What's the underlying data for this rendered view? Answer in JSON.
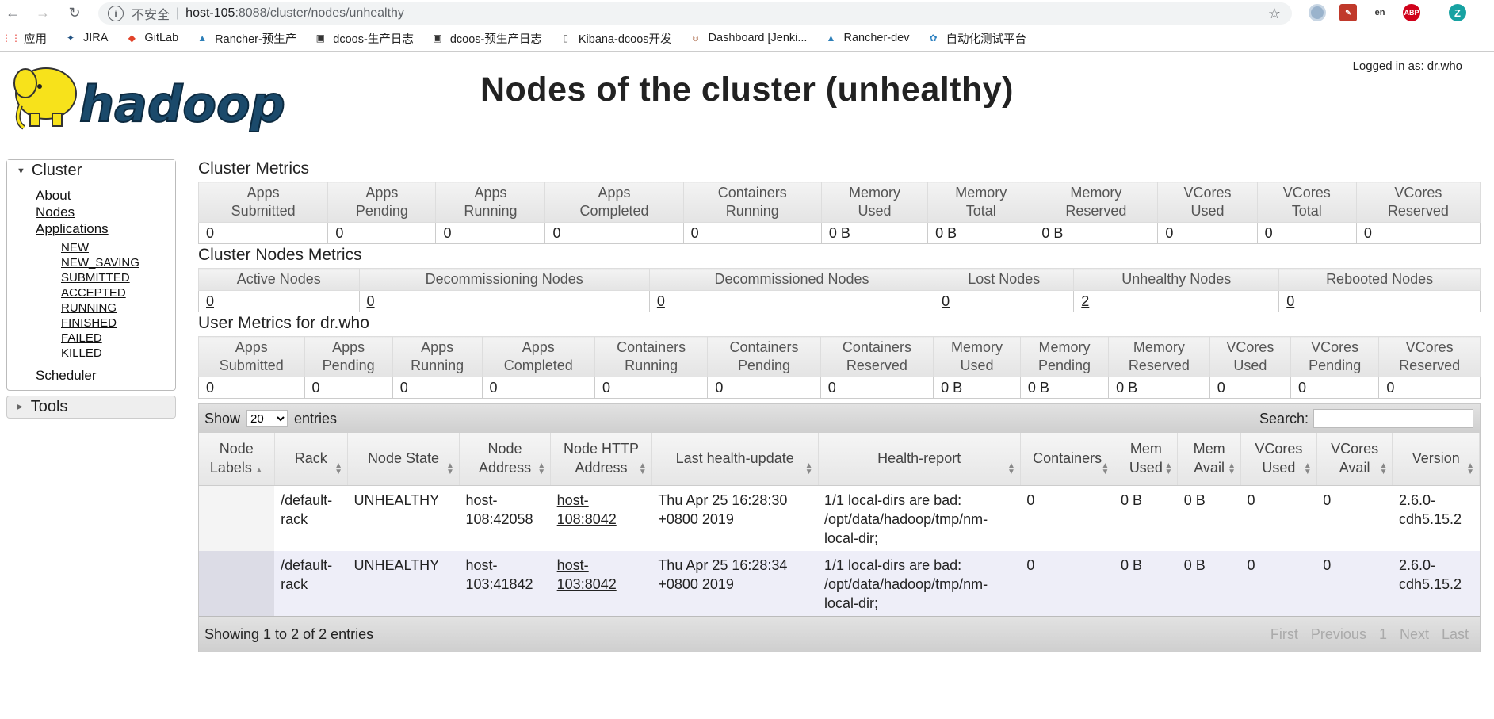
{
  "browser": {
    "security_label": "不安全",
    "url_host": "host-105",
    "url_rest": ":8088/cluster/nodes/unhealthy",
    "bookmarks": [
      {
        "label": "应用",
        "icon": "apps-grid-icon"
      },
      {
        "label": "JIRA",
        "icon": "jira-icon"
      },
      {
        "label": "GitLab",
        "icon": "gitlab-icon"
      },
      {
        "label": "Rancher-预生产",
        "icon": "rancher-icon"
      },
      {
        "label": "dcoos-生产日志",
        "icon": "terminal-icon"
      },
      {
        "label": "dcoos-预生产日志",
        "icon": "terminal-icon"
      },
      {
        "label": "Kibana-dcoos开发",
        "icon": "page-icon"
      },
      {
        "label": "Dashboard [Jenki...",
        "icon": "jenkins-icon"
      },
      {
        "label": "Rancher-dev",
        "icon": "rancher-icon"
      },
      {
        "label": "自动化测试平台",
        "icon": "test-platform-icon"
      }
    ],
    "ext_abp": "ABP",
    "profile_initial": "Z"
  },
  "header": {
    "title": "Nodes of the cluster (unhealthy)",
    "logged_in": "Logged in as: dr.who",
    "logo_text": "hadoop"
  },
  "sidebar": {
    "cluster_label": "Cluster",
    "links": [
      "About",
      "Nodes",
      "Applications"
    ],
    "app_states": [
      "NEW",
      "NEW_SAVING",
      "SUBMITTED",
      "ACCEPTED",
      "RUNNING",
      "FINISHED",
      "FAILED",
      "KILLED"
    ],
    "scheduler": "Scheduler",
    "tools_label": "Tools"
  },
  "cluster_metrics": {
    "title": "Cluster Metrics",
    "headers": [
      [
        "Apps",
        "Submitted"
      ],
      [
        "Apps",
        "Pending"
      ],
      [
        "Apps",
        "Running"
      ],
      [
        "Apps",
        "Completed"
      ],
      [
        "Containers",
        "Running"
      ],
      [
        "Memory",
        "Used"
      ],
      [
        "Memory",
        "Total"
      ],
      [
        "Memory",
        "Reserved"
      ],
      [
        "VCores",
        "Used"
      ],
      [
        "VCores",
        "Total"
      ],
      [
        "VCores",
        "Reserved"
      ]
    ],
    "values": [
      "0",
      "0",
      "0",
      "0",
      "0",
      "0 B",
      "0 B",
      "0 B",
      "0",
      "0",
      "0"
    ]
  },
  "node_metrics": {
    "title": "Cluster Nodes Metrics",
    "headers": [
      "Active Nodes",
      "Decommissioning Nodes",
      "Decommissioned Nodes",
      "Lost Nodes",
      "Unhealthy Nodes",
      "Rebooted Nodes"
    ],
    "values": [
      "0",
      "0",
      "0",
      "0",
      "2",
      "0"
    ]
  },
  "user_metrics": {
    "title": "User Metrics for dr.who",
    "headers": [
      [
        "Apps",
        "Submitted"
      ],
      [
        "Apps",
        "Pending"
      ],
      [
        "Apps",
        "Running"
      ],
      [
        "Apps",
        "Completed"
      ],
      [
        "Containers",
        "Running"
      ],
      [
        "Containers",
        "Pending"
      ],
      [
        "Containers",
        "Reserved"
      ],
      [
        "Memory",
        "Used"
      ],
      [
        "Memory",
        "Pending"
      ],
      [
        "Memory",
        "Reserved"
      ],
      [
        "VCores",
        "Used"
      ],
      [
        "VCores",
        "Pending"
      ],
      [
        "VCores",
        "Reserved"
      ]
    ],
    "values": [
      "0",
      "0",
      "0",
      "0",
      "0",
      "0",
      "0",
      "0 B",
      "0 B",
      "0 B",
      "0",
      "0",
      "0"
    ]
  },
  "nodes_table": {
    "show_label": "Show",
    "entries_label": "entries",
    "page_size": "20",
    "search_label": "Search:",
    "headers": [
      [
        "Node",
        "Labels"
      ],
      [
        "Rack"
      ],
      [
        "Node State"
      ],
      [
        "Node",
        "Address"
      ],
      [
        "Node HTTP",
        "Address"
      ],
      [
        "Last health-update"
      ],
      [
        "Health-report"
      ],
      [
        "Containers"
      ],
      [
        "Mem",
        "Used"
      ],
      [
        "Mem",
        "Avail"
      ],
      [
        "VCores",
        "Used"
      ],
      [
        "VCores",
        "Avail"
      ],
      [
        "Version"
      ]
    ],
    "rows": [
      {
        "labels": "",
        "rack": "/default-rack",
        "state": "UNHEALTHY",
        "address": "host-108:42058",
        "http": "host-108:8042",
        "last_update": "Thu Apr 25 16:28:30 +0800 2019",
        "health": "1/1 local-dirs are bad: /opt/data/hadoop/tmp/nm-local-dir;",
        "containers": "0",
        "mem_used": "0 B",
        "mem_avail": "0 B",
        "vcores_used": "0",
        "vcores_avail": "0",
        "version": "2.6.0-cdh5.15.2"
      },
      {
        "labels": "",
        "rack": "/default-rack",
        "state": "UNHEALTHY",
        "address": "host-103:41842",
        "http": "host-103:8042",
        "last_update": "Thu Apr 25 16:28:34 +0800 2019",
        "health": "1/1 local-dirs are bad: /opt/data/hadoop/tmp/nm-local-dir;",
        "containers": "0",
        "mem_used": "0 B",
        "mem_avail": "0 B",
        "vcores_used": "0",
        "vcores_avail": "0",
        "version": "2.6.0-cdh5.15.2"
      }
    ],
    "info": "Showing 1 to 2 of 2 entries",
    "paging": [
      "First",
      "Previous",
      "1",
      "Next",
      "Last"
    ]
  }
}
